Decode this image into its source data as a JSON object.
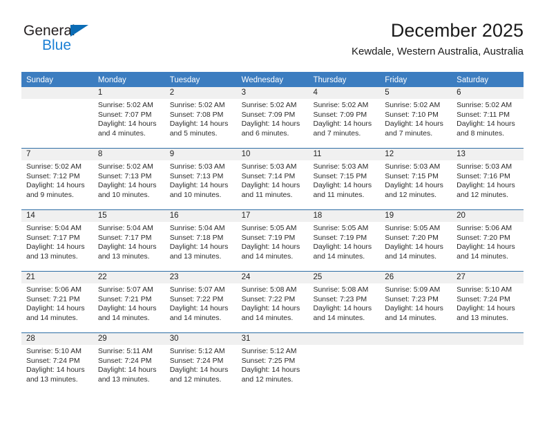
{
  "logo": {
    "word_one": "General",
    "word_two": "Blue",
    "triangle": "triangle-icon",
    "brand_dark": "#231f20",
    "brand_blue": "#1b7fd4",
    "triangle_color": "#0b6cb5"
  },
  "header": {
    "title": "December 2025",
    "subtitle": "Kewdale, Western Australia, Australia"
  },
  "theme": {
    "header_blue": "#3c7dc0",
    "row_divider": "#2d6da5",
    "day_strip": "#f0f0f0",
    "text": "#222222"
  },
  "weekdays": [
    "Sunday",
    "Monday",
    "Tuesday",
    "Wednesday",
    "Thursday",
    "Friday",
    "Saturday"
  ],
  "weeks": [
    [
      {
        "day": "",
        "sunrise": "",
        "sunset": "",
        "daylight_line1": "",
        "daylight_line2": ""
      },
      {
        "day": "1",
        "sunrise": "Sunrise: 5:02 AM",
        "sunset": "Sunset: 7:07 PM",
        "daylight_line1": "Daylight: 14 hours",
        "daylight_line2": "and 4 minutes."
      },
      {
        "day": "2",
        "sunrise": "Sunrise: 5:02 AM",
        "sunset": "Sunset: 7:08 PM",
        "daylight_line1": "Daylight: 14 hours",
        "daylight_line2": "and 5 minutes."
      },
      {
        "day": "3",
        "sunrise": "Sunrise: 5:02 AM",
        "sunset": "Sunset: 7:09 PM",
        "daylight_line1": "Daylight: 14 hours",
        "daylight_line2": "and 6 minutes."
      },
      {
        "day": "4",
        "sunrise": "Sunrise: 5:02 AM",
        "sunset": "Sunset: 7:09 PM",
        "daylight_line1": "Daylight: 14 hours",
        "daylight_line2": "and 7 minutes."
      },
      {
        "day": "5",
        "sunrise": "Sunrise: 5:02 AM",
        "sunset": "Sunset: 7:10 PM",
        "daylight_line1": "Daylight: 14 hours",
        "daylight_line2": "and 7 minutes."
      },
      {
        "day": "6",
        "sunrise": "Sunrise: 5:02 AM",
        "sunset": "Sunset: 7:11 PM",
        "daylight_line1": "Daylight: 14 hours",
        "daylight_line2": "and 8 minutes."
      }
    ],
    [
      {
        "day": "7",
        "sunrise": "Sunrise: 5:02 AM",
        "sunset": "Sunset: 7:12 PM",
        "daylight_line1": "Daylight: 14 hours",
        "daylight_line2": "and 9 minutes."
      },
      {
        "day": "8",
        "sunrise": "Sunrise: 5:02 AM",
        "sunset": "Sunset: 7:13 PM",
        "daylight_line1": "Daylight: 14 hours",
        "daylight_line2": "and 10 minutes."
      },
      {
        "day": "9",
        "sunrise": "Sunrise: 5:03 AM",
        "sunset": "Sunset: 7:13 PM",
        "daylight_line1": "Daylight: 14 hours",
        "daylight_line2": "and 10 minutes."
      },
      {
        "day": "10",
        "sunrise": "Sunrise: 5:03 AM",
        "sunset": "Sunset: 7:14 PM",
        "daylight_line1": "Daylight: 14 hours",
        "daylight_line2": "and 11 minutes."
      },
      {
        "day": "11",
        "sunrise": "Sunrise: 5:03 AM",
        "sunset": "Sunset: 7:15 PM",
        "daylight_line1": "Daylight: 14 hours",
        "daylight_line2": "and 11 minutes."
      },
      {
        "day": "12",
        "sunrise": "Sunrise: 5:03 AM",
        "sunset": "Sunset: 7:15 PM",
        "daylight_line1": "Daylight: 14 hours",
        "daylight_line2": "and 12 minutes."
      },
      {
        "day": "13",
        "sunrise": "Sunrise: 5:03 AM",
        "sunset": "Sunset: 7:16 PM",
        "daylight_line1": "Daylight: 14 hours",
        "daylight_line2": "and 12 minutes."
      }
    ],
    [
      {
        "day": "14",
        "sunrise": "Sunrise: 5:04 AM",
        "sunset": "Sunset: 7:17 PM",
        "daylight_line1": "Daylight: 14 hours",
        "daylight_line2": "and 13 minutes."
      },
      {
        "day": "15",
        "sunrise": "Sunrise: 5:04 AM",
        "sunset": "Sunset: 7:17 PM",
        "daylight_line1": "Daylight: 14 hours",
        "daylight_line2": "and 13 minutes."
      },
      {
        "day": "16",
        "sunrise": "Sunrise: 5:04 AM",
        "sunset": "Sunset: 7:18 PM",
        "daylight_line1": "Daylight: 14 hours",
        "daylight_line2": "and 13 minutes."
      },
      {
        "day": "17",
        "sunrise": "Sunrise: 5:05 AM",
        "sunset": "Sunset: 7:19 PM",
        "daylight_line1": "Daylight: 14 hours",
        "daylight_line2": "and 14 minutes."
      },
      {
        "day": "18",
        "sunrise": "Sunrise: 5:05 AM",
        "sunset": "Sunset: 7:19 PM",
        "daylight_line1": "Daylight: 14 hours",
        "daylight_line2": "and 14 minutes."
      },
      {
        "day": "19",
        "sunrise": "Sunrise: 5:05 AM",
        "sunset": "Sunset: 7:20 PM",
        "daylight_line1": "Daylight: 14 hours",
        "daylight_line2": "and 14 minutes."
      },
      {
        "day": "20",
        "sunrise": "Sunrise: 5:06 AM",
        "sunset": "Sunset: 7:20 PM",
        "daylight_line1": "Daylight: 14 hours",
        "daylight_line2": "and 14 minutes."
      }
    ],
    [
      {
        "day": "21",
        "sunrise": "Sunrise: 5:06 AM",
        "sunset": "Sunset: 7:21 PM",
        "daylight_line1": "Daylight: 14 hours",
        "daylight_line2": "and 14 minutes."
      },
      {
        "day": "22",
        "sunrise": "Sunrise: 5:07 AM",
        "sunset": "Sunset: 7:21 PM",
        "daylight_line1": "Daylight: 14 hours",
        "daylight_line2": "and 14 minutes."
      },
      {
        "day": "23",
        "sunrise": "Sunrise: 5:07 AM",
        "sunset": "Sunset: 7:22 PM",
        "daylight_line1": "Daylight: 14 hours",
        "daylight_line2": "and 14 minutes."
      },
      {
        "day": "24",
        "sunrise": "Sunrise: 5:08 AM",
        "sunset": "Sunset: 7:22 PM",
        "daylight_line1": "Daylight: 14 hours",
        "daylight_line2": "and 14 minutes."
      },
      {
        "day": "25",
        "sunrise": "Sunrise: 5:08 AM",
        "sunset": "Sunset: 7:23 PM",
        "daylight_line1": "Daylight: 14 hours",
        "daylight_line2": "and 14 minutes."
      },
      {
        "day": "26",
        "sunrise": "Sunrise: 5:09 AM",
        "sunset": "Sunset: 7:23 PM",
        "daylight_line1": "Daylight: 14 hours",
        "daylight_line2": "and 14 minutes."
      },
      {
        "day": "27",
        "sunrise": "Sunrise: 5:10 AM",
        "sunset": "Sunset: 7:24 PM",
        "daylight_line1": "Daylight: 14 hours",
        "daylight_line2": "and 13 minutes."
      }
    ],
    [
      {
        "day": "28",
        "sunrise": "Sunrise: 5:10 AM",
        "sunset": "Sunset: 7:24 PM",
        "daylight_line1": "Daylight: 14 hours",
        "daylight_line2": "and 13 minutes."
      },
      {
        "day": "29",
        "sunrise": "Sunrise: 5:11 AM",
        "sunset": "Sunset: 7:24 PM",
        "daylight_line1": "Daylight: 14 hours",
        "daylight_line2": "and 13 minutes."
      },
      {
        "day": "30",
        "sunrise": "Sunrise: 5:12 AM",
        "sunset": "Sunset: 7:24 PM",
        "daylight_line1": "Daylight: 14 hours",
        "daylight_line2": "and 12 minutes."
      },
      {
        "day": "31",
        "sunrise": "Sunrise: 5:12 AM",
        "sunset": "Sunset: 7:25 PM",
        "daylight_line1": "Daylight: 14 hours",
        "daylight_line2": "and 12 minutes."
      },
      {
        "day": "",
        "sunrise": "",
        "sunset": "",
        "daylight_line1": "",
        "daylight_line2": ""
      },
      {
        "day": "",
        "sunrise": "",
        "sunset": "",
        "daylight_line1": "",
        "daylight_line2": ""
      },
      {
        "day": "",
        "sunrise": "",
        "sunset": "",
        "daylight_line1": "",
        "daylight_line2": ""
      }
    ]
  ]
}
